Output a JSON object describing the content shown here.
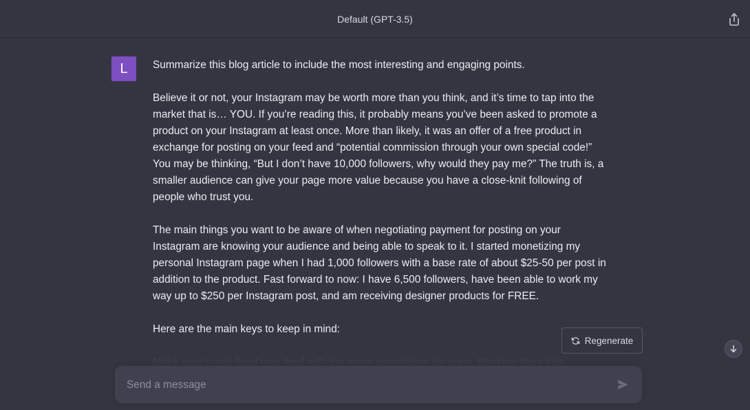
{
  "header": {
    "title": "Default (GPT-3.5)",
    "share_icon": "share-icon"
  },
  "message": {
    "avatar_letter": "L",
    "avatar_color": "#7e4fc0",
    "paragraphs": [
      "Summarize this blog article to include the most interesting and engaging points.",
      "Believe it or not, your Instagram may be worth more than you think, and it’s time to tap into the market that is… YOU. If you’re reading this, it probably means you’ve been asked to promote a product on your Instagram at least once. More than likely, it was an offer of a free product in exchange for posting on your feed and “potential commission through your own special code!”  You may be thinking, “But I don’t have 10,000 followers, why would they pay me?” The truth is, a smaller audience can give your page more value because you have a close-knit following of people who trust you.",
      "The main things you want to be aware of when negotiating payment for posting on your Instagram are knowing your audience and being able to speak to it. I started monetizing my personal Instagram page when I had 1,000 followers with a base rate of about $25-50 per post in addition to the product. Fast forward to now: I have 6,500 followers, have been able to work my way up to $250 per Instagram post, and am receiving designer products for FREE.",
      "Here are the main keys to keep in mind:",
      "Make sure to not flood your feed with too many promotions too soon. Working them into"
    ]
  },
  "actions": {
    "regenerate_label": "Regenerate",
    "regenerate_icon": "refresh-icon",
    "scroll_icon": "arrow-down-icon"
  },
  "composer": {
    "placeholder": "Send a message",
    "send_icon": "send-icon"
  }
}
